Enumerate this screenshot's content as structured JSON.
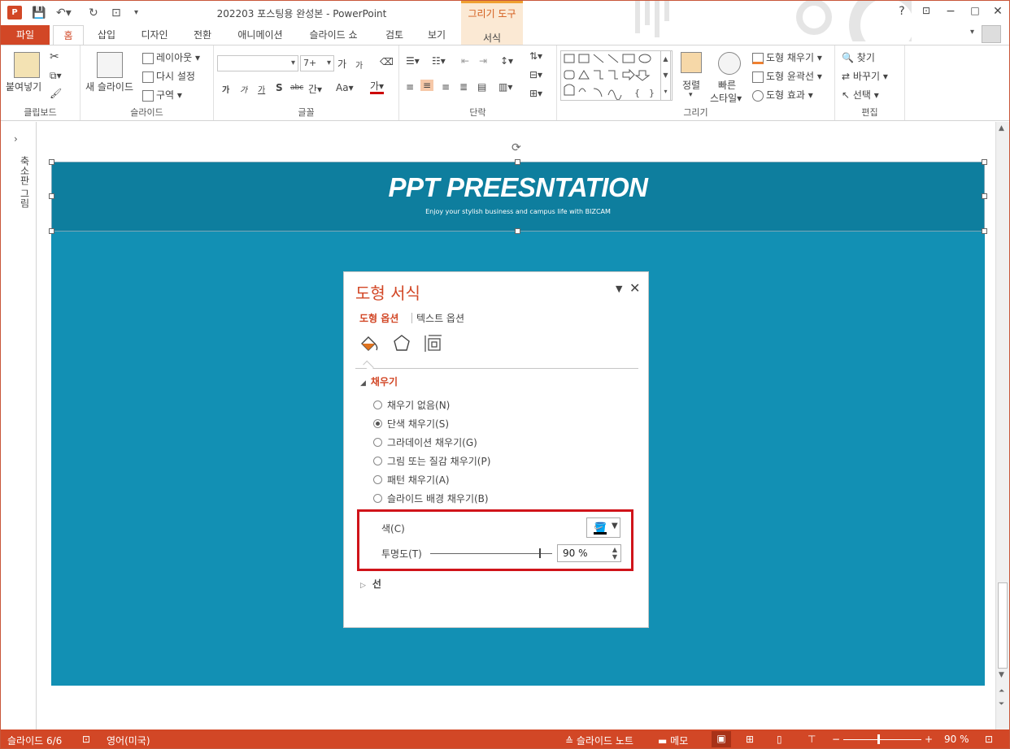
{
  "app": {
    "logo": "P",
    "title": "202203 포스팅용 완성본 - PowerPoint",
    "context_group": "그리기 도구",
    "context_tab": "서식",
    "help": "?"
  },
  "tabs": [
    "파일",
    "홈",
    "삽입",
    "디자인",
    "전환",
    "애니메이션",
    "슬라이드 쇼",
    "검토",
    "보기"
  ],
  "ribbon": {
    "clipboard": {
      "label": "클립보드",
      "paste": "붙여넣기"
    },
    "slides": {
      "label": "슬라이드",
      "new_slide": "새 슬라이드",
      "layout": "레이아웃",
      "reset": "다시 설정",
      "section": "구역"
    },
    "font": {
      "label": "글꼴",
      "size": "7+",
      "grow": "가",
      "shrink": "가",
      "bold": "가",
      "italic": "가",
      "underline": "가",
      "shadow": "S",
      "strike": "abc",
      "spacing": "간",
      "case": "Aa",
      "color": "가"
    },
    "paragraph": {
      "label": "단락"
    },
    "drawing": {
      "label": "그리기",
      "arrange": "정렬",
      "quick_styles_1": "빠른",
      "quick_styles_2": "스타일",
      "fill": "도형 채우기",
      "outline": "도형 윤곽선",
      "effects": "도형 효과"
    },
    "editing": {
      "label": "편집",
      "find": "찾기",
      "replace": "바꾸기",
      "select": "선택"
    }
  },
  "thumb_panel": {
    "label": "축소판 그림"
  },
  "slide": {
    "title": "PPT PREESNTATION",
    "subtitle": "Enjoy your stylish business and campus life with BIZCAM"
  },
  "format_pane": {
    "title": "도형 서식",
    "tab_shape": "도형 옵션",
    "tab_text": "텍스트 옵션",
    "fill_section": "채우기",
    "fill_options": [
      {
        "label": "채우기 없음(N)",
        "selected": false
      },
      {
        "label": "단색 채우기(S)",
        "selected": true
      },
      {
        "label": "그라데이션 채우기(G)",
        "selected": false
      },
      {
        "label": "그림 또는 질감 채우기(P)",
        "selected": false
      },
      {
        "label": "패턴 채우기(A)",
        "selected": false
      },
      {
        "label": "슬라이드 배경 채우기(B)",
        "selected": false
      }
    ],
    "color_label": "색(C)",
    "transparency_label": "투명도(T)",
    "transparency_value": "90 %",
    "transparency_fraction": 0.9,
    "line_section": "선"
  },
  "status": {
    "slide_counter": "슬라이드 6/6",
    "language": "영어(미국)",
    "notes": "슬라이드 노트",
    "comments": "메모",
    "zoom": "90 %"
  },
  "colors": {
    "accent": "#d24726",
    "slide_bg": "#1290b4",
    "banner_bg": "#0e7e9e",
    "highlight": "#d0141a"
  }
}
